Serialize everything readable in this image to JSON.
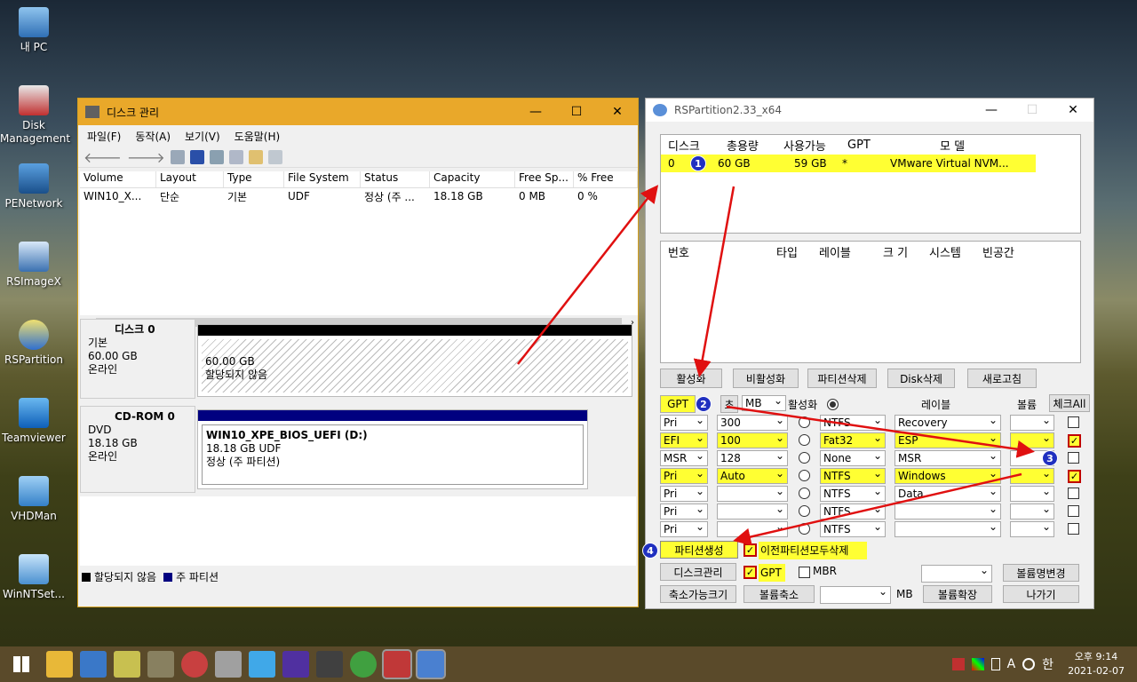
{
  "desktop": {
    "icons": [
      {
        "label": "내 PC"
      },
      {
        "label": "Disk Management"
      },
      {
        "label": "PENetwork"
      },
      {
        "label": "RSImageX"
      },
      {
        "label": "RSPartition"
      },
      {
        "label": "Teamviewer"
      },
      {
        "label": "VHDMan"
      },
      {
        "label": "WinNTSet..."
      }
    ]
  },
  "dm": {
    "title": "디스크 관리",
    "menu": [
      "파일(F)",
      "동작(A)",
      "보기(V)",
      "도움말(H)"
    ],
    "columns": [
      "Volume",
      "Layout",
      "Type",
      "File System",
      "Status",
      "Capacity",
      "Free Sp...",
      "% Free"
    ],
    "rows": [
      [
        "WIN10_X...",
        "단순",
        "기본",
        "UDF",
        "정상 (주 ...",
        "18.18 GB",
        "0 MB",
        "0 %"
      ]
    ],
    "disk0": {
      "name": "디스크 0",
      "type": "기본",
      "size": "60.00 GB",
      "status": "온라인",
      "part_size": "60.00 GB",
      "part_label": "할당되지 않음"
    },
    "cdrom": {
      "name": "CD-ROM 0",
      "type": "DVD",
      "size": "18.18 GB",
      "status": "온라인",
      "vol_name": "WIN10_XPE_BIOS_UEFI  (D:)",
      "vol_size": "18.18 GB UDF",
      "vol_status": "정상 (주 파티션)"
    },
    "legend": {
      "unalloc": "할당되지 않음",
      "primary": "주 파티션"
    }
  },
  "rs": {
    "title": "RSPartition2.33_x64",
    "disk_cols": [
      "디스크",
      "총용량",
      "사용가능",
      "GPT",
      "모    델"
    ],
    "disk_row": [
      "0",
      "60 GB",
      "59 GB",
      "*",
      "VMware Virtual NVM..."
    ],
    "part_cols": [
      "번호",
      "타입",
      "레이블",
      "크 기",
      "시스템",
      "빈공간"
    ],
    "buttons": {
      "activate": "활성화",
      "deactivate": "비활성화",
      "del_part": "파티션삭제",
      "del_disk": "Disk삭제",
      "refresh": "새로고침",
      "create": "파티션생성",
      "diskmgmt": "디스크관리",
      "rename": "볼륨명변경",
      "shrinkable": "축소가능크기",
      "shrink": "볼륨축소",
      "extend": "볼륨확장",
      "exit": "나가기"
    },
    "hdr": {
      "gpt": "GPT",
      "cho": "초",
      "unit": "MB",
      "active": "활성화",
      "label": "레이블",
      "volume": "볼륨",
      "check_all": "체크All"
    },
    "rows": [
      {
        "type": "Pri",
        "size": "300",
        "fs": "NTFS",
        "label": "Recovery",
        "checked": false,
        "hl": false
      },
      {
        "type": "EFI",
        "size": "100",
        "fs": "Fat32",
        "label": "ESP",
        "checked": true,
        "hl": true
      },
      {
        "type": "MSR",
        "size": "128",
        "fs": "None",
        "label": "MSR",
        "checked": false,
        "hl": false
      },
      {
        "type": "Pri",
        "size": "Auto",
        "fs": "NTFS",
        "label": "Windows",
        "checked": true,
        "hl": true
      },
      {
        "type": "Pri",
        "size": "",
        "fs": "NTFS",
        "label": "Data",
        "checked": false,
        "hl": false
      },
      {
        "type": "Pri",
        "size": "",
        "fs": "NTFS",
        "label": "",
        "checked": false,
        "hl": false
      },
      {
        "type": "Pri",
        "size": "",
        "fs": "NTFS",
        "label": "",
        "checked": false,
        "hl": false
      }
    ],
    "opt_delete_all": "이전파티션모두삭제",
    "opt_gpt": "GPT",
    "opt_mbr": "MBR",
    "mb_unit": "MB",
    "badges": [
      "1",
      "2",
      "3",
      "4"
    ]
  },
  "taskbar": {
    "time": "오후 9:14",
    "date": "2021-02-07",
    "lang": "A",
    "ime": "한"
  }
}
